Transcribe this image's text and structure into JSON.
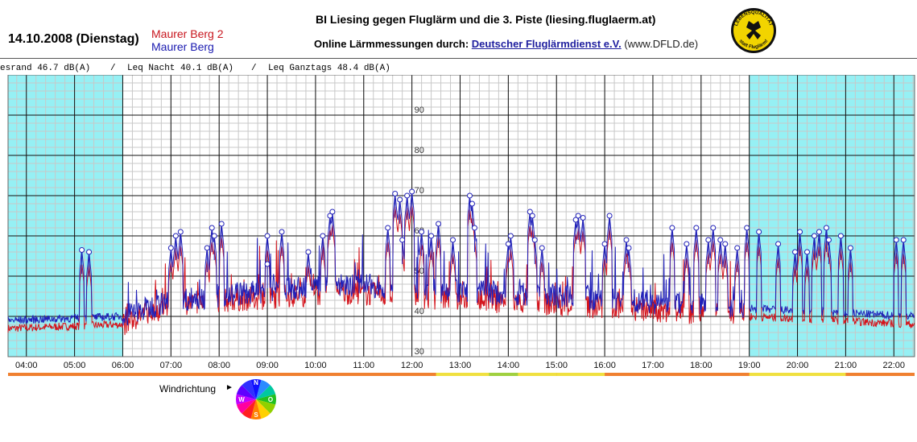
{
  "header": {
    "date": "14.10.2008 (Dienstag)",
    "station_1": "Maurer Berg 2",
    "station_2": "Maurer Berg",
    "title": "BI Liesing gegen Fluglärm und die 3. Piste (liesing.fluglaerm.at)",
    "online_label": "Online Lärmmessungen durch:",
    "online_link": "Deutscher Fluglärmdienst e.V.",
    "online_domain": "(www.DFLD.de)",
    "logo_top_text": "LEBENSQUALITÄT",
    "logo_bottom_text": "statt Fluglärm!"
  },
  "leq": {
    "day": "esrand 46.7 dB(A)",
    "sep1": "/",
    "night": "Leq Nacht 40.1 dB(A)",
    "sep2": "/",
    "allday": "Leq Ganztags 48.4 dB(A)"
  },
  "wind": {
    "label": "Windrichtung",
    "arrow": "►",
    "directions": [
      "N",
      "O",
      "S",
      "W"
    ]
  },
  "colors": {
    "series_1": "#d4141c",
    "series_2": "#2020b8",
    "night_shade": "#96f0f4",
    "grid": "#c8c8c8"
  },
  "chart_data": {
    "type": "line",
    "x_unit": "time of day (hours)",
    "x_ticks": [
      "04:00",
      "05:00",
      "06:00",
      "07:00",
      "08:00",
      "09:00",
      "10:00",
      "11:00",
      "12:00",
      "13:00",
      "14:00",
      "15:00",
      "16:00",
      "17:00",
      "18:00",
      "19:00",
      "20:00",
      "21:00",
      "22:00"
    ],
    "y_ticks": [
      30,
      40,
      50,
      60,
      70,
      80,
      90
    ],
    "y_tick_labels": [
      "30",
      "40",
      "50",
      "60",
      "70",
      "80",
      "90"
    ],
    "xlim": [
      3.62,
      22.43
    ],
    "ylim": [
      30,
      100
    ],
    "shaded_night": [
      [
        3.62,
        6.0
      ],
      [
        19.0,
        22.43
      ]
    ],
    "series": [
      {
        "name": "Maurer Berg 2",
        "base": [
          [
            3.62,
            37
          ],
          [
            6.0,
            38
          ],
          [
            7.0,
            43
          ],
          [
            10.5,
            46
          ],
          [
            12.0,
            45
          ],
          [
            15.0,
            43
          ],
          [
            19.0,
            40
          ],
          [
            22.43,
            38
          ]
        ]
      },
      {
        "name": "Maurer Berg",
        "base": [
          [
            3.62,
            39
          ],
          [
            6.0,
            40
          ],
          [
            7.0,
            44
          ],
          [
            10.5,
            48
          ],
          [
            12.0,
            47
          ],
          [
            15.0,
            45
          ],
          [
            19.0,
            42
          ],
          [
            22.43,
            40
          ]
        ]
      }
    ],
    "peaks": [
      [
        5.15,
        56.5
      ],
      [
        5.3,
        56
      ],
      [
        7.0,
        57
      ],
      [
        7.1,
        60
      ],
      [
        7.2,
        61
      ],
      [
        7.75,
        57
      ],
      [
        7.85,
        62
      ],
      [
        7.9,
        60
      ],
      [
        8.05,
        63
      ],
      [
        9.0,
        60
      ],
      [
        9.3,
        61
      ],
      [
        9.0,
        53
      ],
      [
        9.85,
        56
      ],
      [
        10.15,
        60
      ],
      [
        10.3,
        65
      ],
      [
        10.35,
        66
      ],
      [
        11.5,
        62
      ],
      [
        11.65,
        70.5
      ],
      [
        11.75,
        69
      ],
      [
        11.8,
        59
      ],
      [
        11.9,
        70
      ],
      [
        12.0,
        71
      ],
      [
        12.2,
        61
      ],
      [
        12.4,
        60
      ],
      [
        12.55,
        63
      ],
      [
        12.85,
        59
      ],
      [
        13.2,
        70
      ],
      [
        13.25,
        68
      ],
      [
        13.3,
        62
      ],
      [
        14.05,
        60
      ],
      [
        14.0,
        58
      ],
      [
        14.45,
        66
      ],
      [
        14.5,
        65
      ],
      [
        14.7,
        57
      ],
      [
        14.55,
        59
      ],
      [
        15.45,
        65
      ],
      [
        15.4,
        64
      ],
      [
        15.55,
        64.5
      ],
      [
        16.0,
        58
      ],
      [
        16.1,
        65
      ],
      [
        16.45,
        59
      ],
      [
        16.5,
        57
      ],
      [
        17.4,
        62
      ],
      [
        17.7,
        58
      ],
      [
        17.9,
        62
      ],
      [
        18.15,
        59
      ],
      [
        18.25,
        62
      ],
      [
        18.4,
        59
      ],
      [
        18.5,
        58
      ],
      [
        18.75,
        57
      ],
      [
        18.95,
        62
      ],
      [
        19.2,
        61
      ],
      [
        19.6,
        58
      ],
      [
        19.95,
        56
      ],
      [
        20.05,
        61
      ],
      [
        20.2,
        56
      ],
      [
        20.35,
        60
      ],
      [
        20.45,
        61
      ],
      [
        20.6,
        62
      ],
      [
        20.65,
        59
      ],
      [
        20.9,
        60
      ],
      [
        21.1,
        57
      ],
      [
        22.05,
        59
      ],
      [
        22.2,
        59
      ]
    ]
  }
}
